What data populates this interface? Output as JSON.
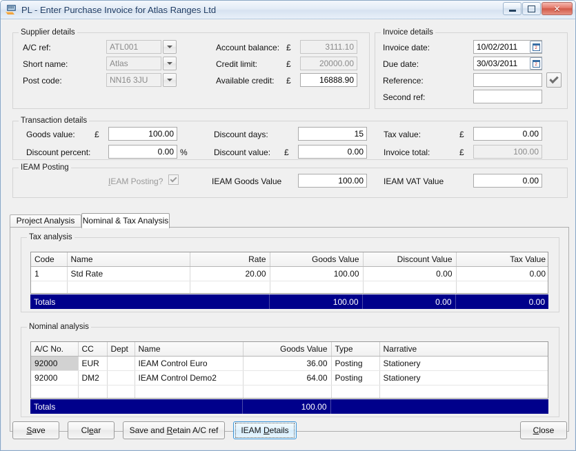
{
  "window": {
    "title": "PL - Enter Purchase Invoice for Atlas Ranges Ltd",
    "icon": "invoice-app-icon",
    "controls": {
      "minimize": "minimize-icon",
      "restore": "restore-icon",
      "close": "close-icon"
    },
    "accent_navy": "#00008b",
    "accent_focus_blue": "#3c93d6"
  },
  "supplier": {
    "legend": "Supplier details",
    "ac_ref_label": "A/C ref:",
    "ac_ref_value": "ATL001",
    "short_name_label": "Short name:",
    "short_name_value": "Atlas",
    "post_code_label": "Post code:",
    "post_code_value": "NN16 3JU",
    "account_balance_label": "Account balance:",
    "account_balance_currency": "£",
    "account_balance_value": "3111.10",
    "credit_limit_label": "Credit limit:",
    "credit_limit_currency": "£",
    "credit_limit_value": "20000.00",
    "available_credit_label": "Available credit:",
    "available_credit_currency": "£",
    "available_credit_value": "16888.90"
  },
  "invoice": {
    "legend": "Invoice details",
    "invoice_date_label": "Invoice date:",
    "invoice_date_value": "10/02/2011",
    "due_date_label": "Due date:",
    "due_date_value": "30/03/2011",
    "reference_label": "Reference:",
    "reference_value": "",
    "reference_placeholder": "",
    "second_ref_label": "Second ref:",
    "second_ref_value": "",
    "second_ref_placeholder": ""
  },
  "transaction": {
    "legend": "Transaction details",
    "goods_value_label": "Goods value:",
    "goods_value_currency": "£",
    "goods_value": "100.00",
    "discount_percent_label": "Discount percent:",
    "discount_percent_value": "0.00",
    "discount_percent_suffix": "%",
    "discount_days_label": "Discount days:",
    "discount_days_value": "15",
    "discount_value_label": "Discount value:",
    "discount_value_currency": "£",
    "discount_value": "0.00",
    "tax_value_label": "Tax value:",
    "tax_value_currency": "£",
    "tax_value": "0.00",
    "invoice_total_label": "Invoice total:",
    "invoice_total_currency": "£",
    "invoice_total_value": "100.00"
  },
  "ieam": {
    "legend": "IEAM Posting",
    "posting_label": "IEAM Posting?",
    "posting_checked": true,
    "goods_value_label": "IEAM Goods Value",
    "goods_value": "100.00",
    "vat_value_label": "IEAM VAT Value",
    "vat_value": "0.00"
  },
  "tabs": [
    {
      "label": "Project Analysis",
      "active": false
    },
    {
      "label": "Nominal & Tax Analysis",
      "active": true
    }
  ],
  "tax_analysis": {
    "legend": "Tax analysis",
    "columns": [
      "Code",
      "Name",
      "Rate",
      "Goods Value",
      "Discount Value",
      "Tax Value"
    ],
    "rows": [
      {
        "code": "1",
        "name": "Std Rate",
        "rate": "20.00",
        "goods_value": "100.00",
        "discount_value": "0.00",
        "tax_value": "0.00"
      }
    ],
    "totals_label": "Totals",
    "totals": {
      "goods_value": "100.00",
      "discount_value": "0.00",
      "tax_value": "0.00"
    }
  },
  "nominal_analysis": {
    "legend": "Nominal analysis",
    "columns": [
      "A/C No.",
      "CC",
      "Dept",
      "Name",
      "Goods Value",
      "Type",
      "Narrative"
    ],
    "rows": [
      {
        "ac_no": "92000",
        "cc": "EUR",
        "dept": "",
        "name": "IEAM Control Euro",
        "goods_value": "36.00",
        "type": "Posting",
        "narrative": "Stationery"
      },
      {
        "ac_no": "92000",
        "cc": "DM2",
        "dept": "",
        "name": "IEAM Control Demo2",
        "goods_value": "64.00",
        "type": "Posting",
        "narrative": "Stationery"
      }
    ],
    "totals_label": "Totals",
    "totals": {
      "goods_value": "100.00"
    }
  },
  "footer": {
    "save": "Save",
    "clear": "Clear",
    "save_retain": "Save and Retain A/C ref",
    "ieam_details": "IEAM Details",
    "close": "Close"
  }
}
